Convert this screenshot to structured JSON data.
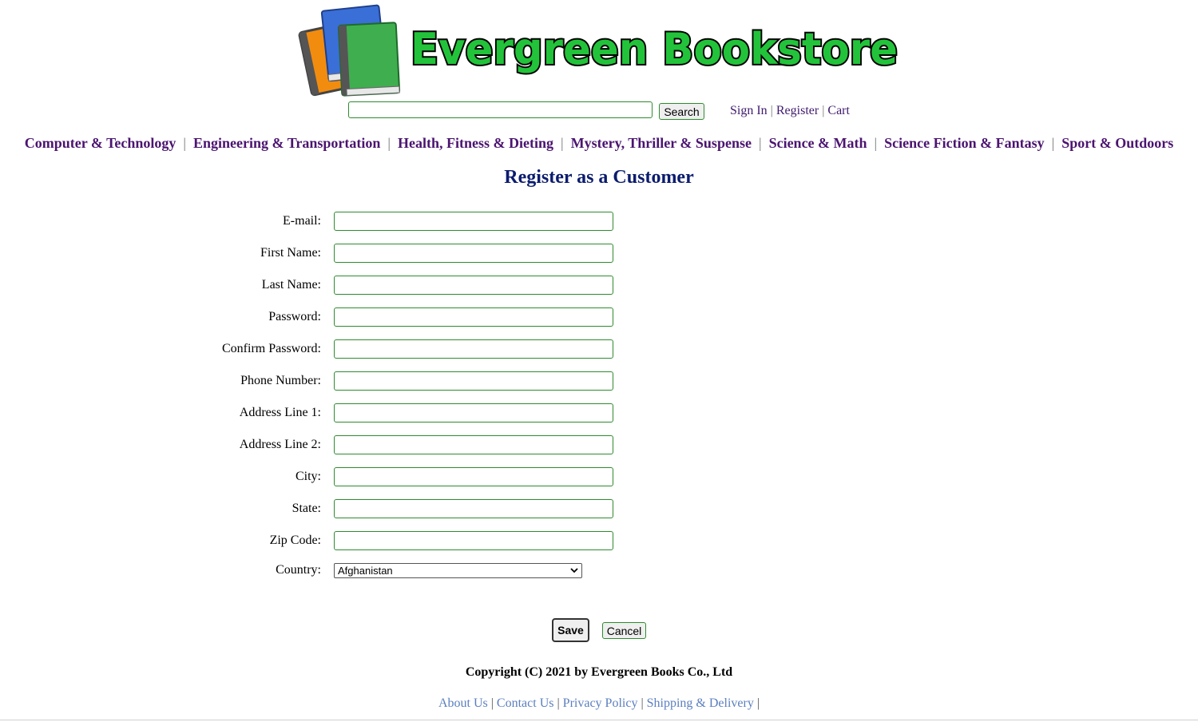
{
  "site": {
    "name": "Evergreen Bookstore",
    "brand_color": "#22c33a"
  },
  "header": {
    "search_value": "",
    "search_button": "Search",
    "account_links": [
      "Sign In",
      "Register",
      "Cart"
    ],
    "separator": "|"
  },
  "categories": [
    "Computer & Technology",
    "Engineering & Transportation",
    "Health, Fitness & Dieting",
    "Mystery, Thriller & Suspense",
    "Science & Math",
    "Science Fiction & Fantasy",
    "Sport & Outdoors"
  ],
  "form": {
    "title": "Register as a Customer",
    "fields": [
      {
        "label": "E-mail:",
        "value": ""
      },
      {
        "label": "First Name:",
        "value": ""
      },
      {
        "label": "Last Name:",
        "value": ""
      },
      {
        "label": "Password:",
        "value": ""
      },
      {
        "label": "Confirm Password:",
        "value": ""
      },
      {
        "label": "Phone Number:",
        "value": ""
      },
      {
        "label": "Address Line 1:",
        "value": ""
      },
      {
        "label": "Address Line 2:",
        "value": ""
      },
      {
        "label": "City:",
        "value": ""
      },
      {
        "label": "State:",
        "value": ""
      },
      {
        "label": "Zip Code:",
        "value": ""
      }
    ],
    "country_label": "Country:",
    "country_selected": "Afghanistan",
    "save_label": "Save",
    "cancel_label": "Cancel"
  },
  "footer": {
    "copyright": "Copyright (C) 2021 by Evergreen Books Co., Ltd",
    "links": [
      "About Us",
      "Contact Us",
      "Privacy Policy",
      "Shipping & Delivery"
    ],
    "separator": "|"
  },
  "colors": {
    "nav_link": "#4b1470",
    "title": "#0b1c6e",
    "input_border": "#2e8b2e",
    "footer_link": "#5b7fbf"
  }
}
